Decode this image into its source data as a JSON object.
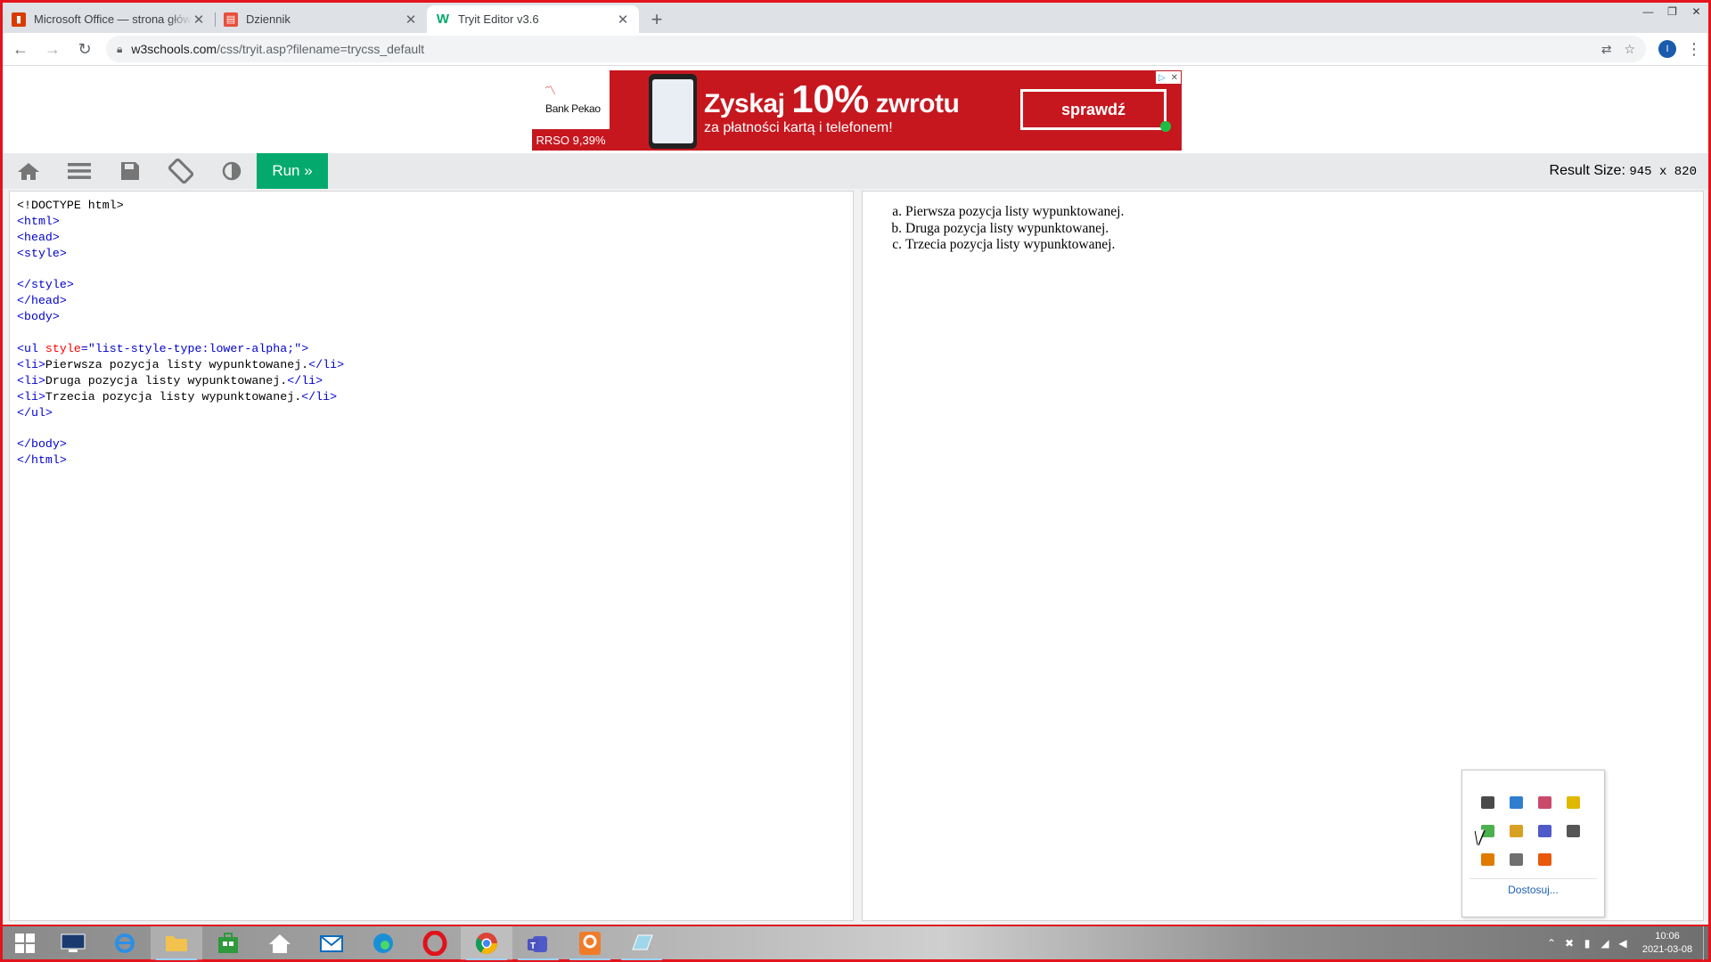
{
  "browser": {
    "tabs": [
      {
        "title": "Microsoft Office — strona główna",
        "icon": "office-icon",
        "active": false
      },
      {
        "title": "Dziennik",
        "icon": "dziennik-icon",
        "active": false
      },
      {
        "title": "Tryit Editor v3.6",
        "icon": "w3schools-icon",
        "active": true
      }
    ],
    "url_host": "w3schools.com",
    "url_path": "/css/tryit.asp?filename=trycss_default",
    "profile_initial": "I"
  },
  "ad": {
    "bank_name": "Bank Pekao",
    "rrso": "RRSO 9,39%",
    "headline_a": "Zyskaj ",
    "headline_pct": "10%",
    "headline_b": " zwrotu",
    "subline": "za płatności kartą i telefonem!",
    "cta": "sprawdź"
  },
  "editor": {
    "run_label": "Run »",
    "result_size_label": "Result Size: ",
    "result_width": "945",
    "result_x": " x ",
    "result_height": "820",
    "code_lines": [
      [
        [
          "doc",
          "<!DOCTYPE html>"
        ]
      ],
      [
        [
          "tag",
          "<html>"
        ]
      ],
      [
        [
          "tag",
          "<head>"
        ]
      ],
      [
        [
          "tag",
          "<style>"
        ]
      ],
      [],
      [
        [
          "tag",
          "</style>"
        ]
      ],
      [
        [
          "tag",
          "</head>"
        ]
      ],
      [
        [
          "tag",
          "<body>"
        ]
      ],
      [],
      [
        [
          "tag",
          "<ul "
        ],
        [
          "attr",
          "style"
        ],
        [
          "tag",
          "="
        ],
        [
          "val",
          "\"list-style-type:lower-alpha;\""
        ],
        [
          "tag",
          ">"
        ]
      ],
      [
        [
          "tag",
          "<li>"
        ],
        [
          "txt",
          "Pierwsza pozycja listy wypunktowanej."
        ],
        [
          "tag",
          "</li>"
        ]
      ],
      [
        [
          "tag",
          "<li>"
        ],
        [
          "txt",
          "Druga pozycja listy wypunktowanej."
        ],
        [
          "tag",
          "</li>"
        ]
      ],
      [
        [
          "tag",
          "<li>"
        ],
        [
          "txt",
          "Trzecia pozycja listy wypunktowanej."
        ],
        [
          "tag",
          "</li>"
        ]
      ],
      [
        [
          "tag",
          "</ul>"
        ]
      ],
      [],
      [
        [
          "tag",
          "</body>"
        ]
      ],
      [
        [
          "tag",
          "</html>"
        ]
      ]
    ]
  },
  "result": {
    "items": [
      {
        "marker": "a.",
        "text": "Pierwsza pozycja listy wypunktowanej."
      },
      {
        "marker": "b.",
        "text": "Druga pozycja listy wypunktowanej."
      },
      {
        "marker": "c.",
        "text": "Trzecia pozycja listy wypunktowanej."
      }
    ]
  },
  "tray_popup": {
    "icons": [
      {
        "name": "display-icon",
        "color": "#4a4a4a"
      },
      {
        "name": "network-drive-icon",
        "color": "#2f7fd1"
      },
      {
        "name": "bluetooth-like-icon",
        "color": "#c94a6b"
      },
      {
        "name": "sync-icon",
        "color": "#e0b800"
      },
      {
        "name": "security-check-icon",
        "color": "#4caf50"
      },
      {
        "name": "package-icon",
        "color": "#d9a021"
      },
      {
        "name": "teams-icon",
        "color": "#5059c9"
      },
      {
        "name": "device-icon",
        "color": "#555555"
      },
      {
        "name": "update-icon",
        "color": "#e07b00"
      },
      {
        "name": "printer-icon",
        "color": "#707070"
      },
      {
        "name": "app-orange-icon",
        "color": "#e8590c"
      }
    ],
    "link": "Dostosuj..."
  },
  "taskbar": {
    "clock_time": "10:06",
    "clock_date": "2021-03-08"
  },
  "colors": {
    "run_green": "#04aa6d",
    "frame_red": "#e3141b",
    "ad_red": "#c6171f"
  }
}
